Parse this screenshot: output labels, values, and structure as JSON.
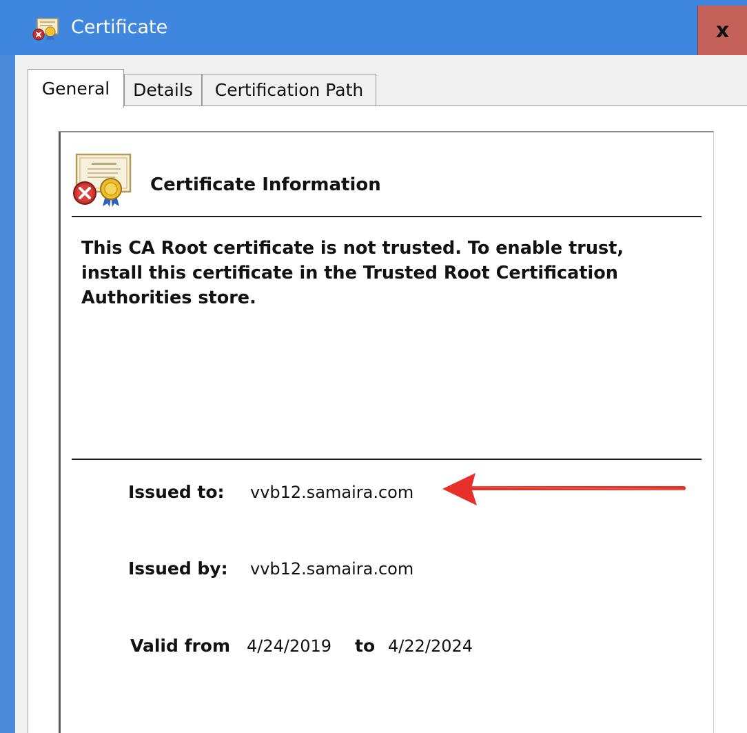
{
  "window": {
    "title": "Certificate",
    "close_label": "x"
  },
  "tabs": [
    {
      "label": "General",
      "active": true
    },
    {
      "label": "Details",
      "active": false
    },
    {
      "label": "Certification Path",
      "active": false
    }
  ],
  "general": {
    "heading": "Certificate Information",
    "warning": "This CA Root certificate is not trusted. To enable trust, install this certificate in the Trusted Root Certification Authorities store.",
    "issued_to_label": "Issued to:",
    "issued_to_value": "vvb12.samaira.com",
    "issued_by_label": "Issued by:",
    "issued_by_value": "vvb12.samaira.com",
    "valid_from_label": "Valid from",
    "valid_from_value": "4/24/2019",
    "valid_to_label": "to",
    "valid_to_value": "4/22/2024"
  },
  "icons": {
    "title_icon": "certificate-error-icon",
    "cert_icon": "certificate-error-icon",
    "arrow": "red-arrow-annotation"
  },
  "colors": {
    "titlebar": "#3f86de",
    "close_button": "#c4625a",
    "arrow": "#e8302a"
  }
}
